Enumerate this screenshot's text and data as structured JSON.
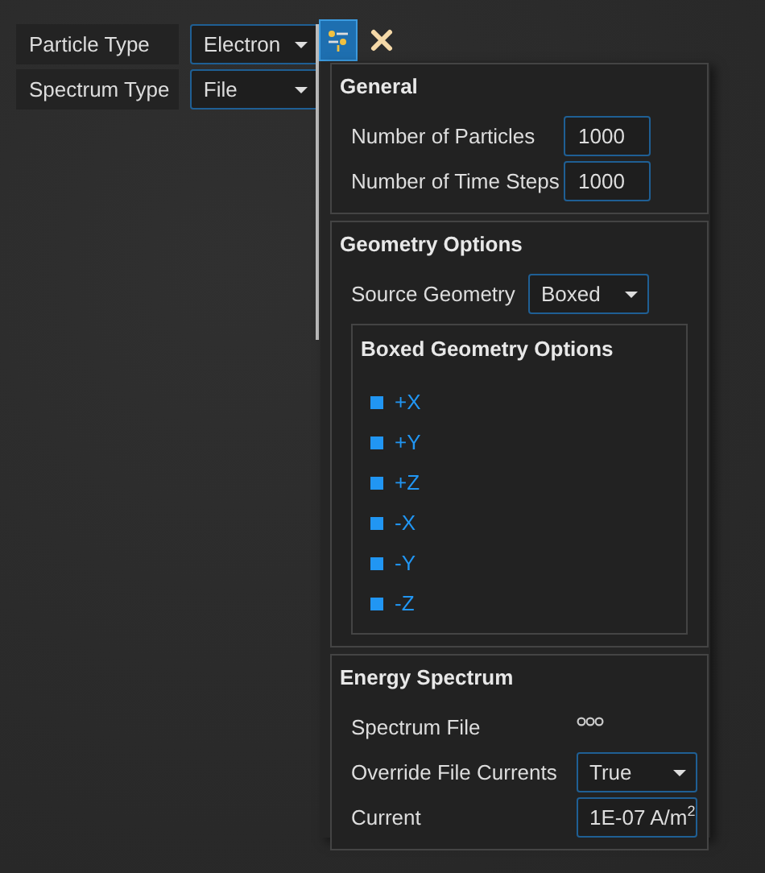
{
  "properties": [
    {
      "label": "Particle Type",
      "value": "Electron",
      "kind": "dropdown"
    },
    {
      "label": "Spectrum Type",
      "value": "File",
      "kind": "dropdown"
    }
  ],
  "popup": {
    "sections": [
      {
        "title": "General",
        "fields": [
          {
            "label": "Number of Particles",
            "value": "1000",
            "kind": "input"
          },
          {
            "label": "Number of Time Steps",
            "value": "1000",
            "kind": "input"
          }
        ]
      },
      {
        "title": "Geometry Options",
        "fields": [
          {
            "label": "Source Geometry",
            "value": "Boxed",
            "kind": "dropdown"
          }
        ],
        "subgroup": {
          "title": "Boxed Geometry Options",
          "items": [
            "+X",
            "+Y",
            "+Z",
            "-X",
            "-Y",
            "-Z"
          ]
        }
      },
      {
        "title": "Energy Spectrum",
        "fields": [
          {
            "label": "Spectrum File",
            "kind": "file"
          },
          {
            "label": "Override File Currents",
            "value": "True",
            "kind": "dropdown"
          },
          {
            "label": "Current",
            "value": "1E-07 A/m$^{2}$",
            "kind": "input"
          }
        ]
      }
    ]
  }
}
